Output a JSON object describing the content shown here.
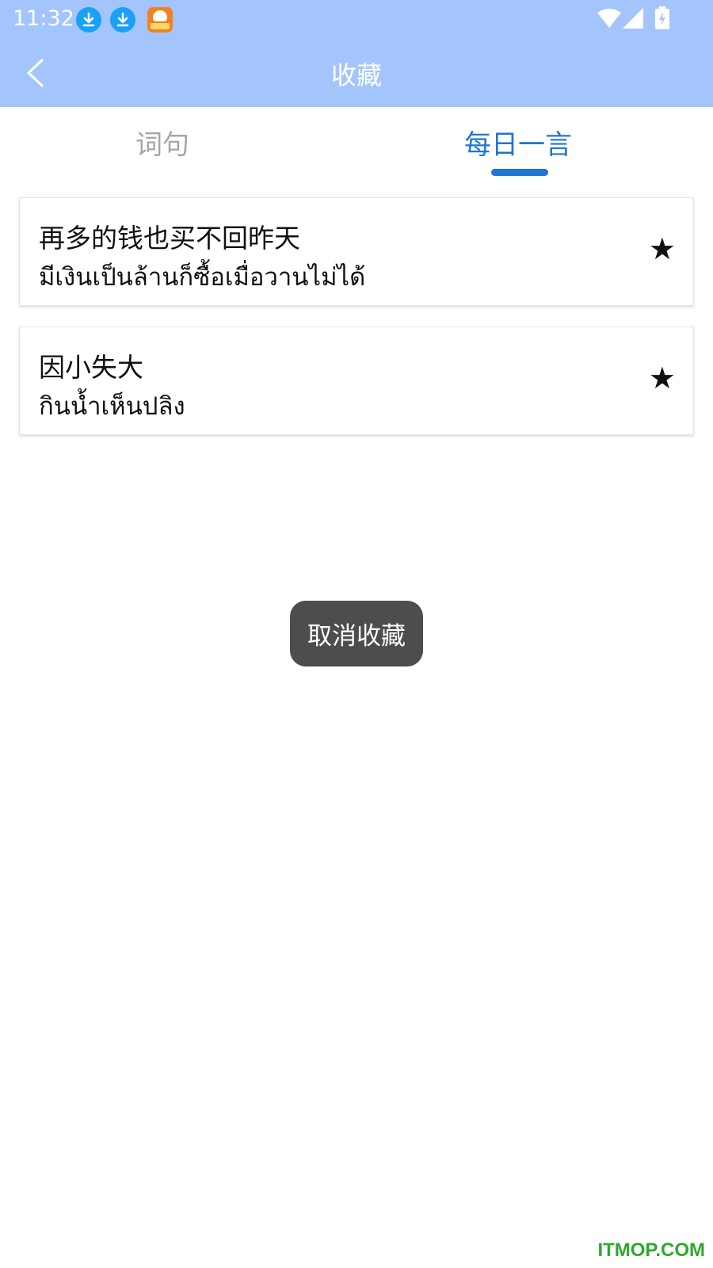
{
  "status_bar": {
    "time": "11:32",
    "icons": [
      "download-icon",
      "download-icon",
      "app-icon",
      "wifi-icon",
      "signal-icon",
      "battery-charging-icon"
    ]
  },
  "header": {
    "title": "收藏",
    "back_icon": "chevron-left-icon"
  },
  "tabs": [
    {
      "label": "词句",
      "active": false
    },
    {
      "label": "每日一言",
      "active": true
    }
  ],
  "items": [
    {
      "zh": "再多的钱也买不回昨天",
      "th": "มีเงินเป็นล้านก็ซื้อเมื่อวานไม่ได้",
      "star": "★"
    },
    {
      "zh": "因小失大",
      "th": "กินน้ำเห็นปลิง",
      "star": "★"
    }
  ],
  "toast": "取消收藏",
  "watermark": "ITMOP.COM",
  "colors": {
    "header_bg": "#a3c5fb",
    "active_tab": "#1f74d3",
    "inactive_tab": "#a6a6a6",
    "toast_bg": "#4d4d4d"
  }
}
